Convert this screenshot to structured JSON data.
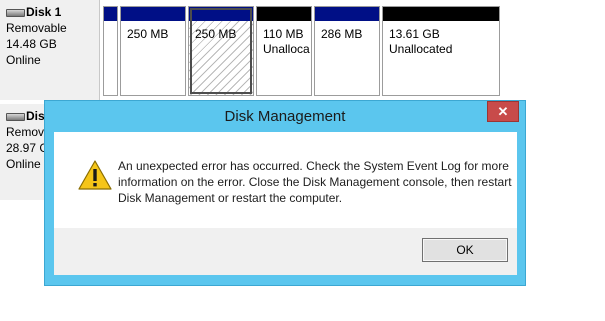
{
  "disks": [
    {
      "name": "Disk 1",
      "type": "Removable",
      "size": "14.48 GB",
      "status": "Online",
      "partitions": [
        {
          "size": "",
          "status": "",
          "bar": "blue"
        },
        {
          "size": "250 MB",
          "status": "",
          "bar": "blue"
        },
        {
          "size": "250 MB",
          "status": "",
          "bar": "blue",
          "hatched": true,
          "selected": true
        },
        {
          "size": "110 MB",
          "status": "Unalloca",
          "bar": "black"
        },
        {
          "size": "286 MB",
          "status": "",
          "bar": "blue"
        },
        {
          "size": "13.61 GB",
          "status": "Unallocated",
          "bar": "black"
        }
      ]
    },
    {
      "name": "Disk",
      "type": "Remov",
      "size": "28.97 G",
      "status": "Online"
    }
  ],
  "dialog": {
    "title": "Disk Management",
    "close_label": "✕",
    "icon": "warning-icon",
    "message": "An unexpected error has occurred. Check the System Event Log for more information on the error. Close the Disk Management console, then restart Disk Management or restart the computer.",
    "ok_label": "OK"
  },
  "colors": {
    "dialog_frame": "#5bc6ee",
    "close_button": "#c84b4a",
    "primary_partition_bar": "#000f86",
    "unallocated_bar": "#000000"
  }
}
